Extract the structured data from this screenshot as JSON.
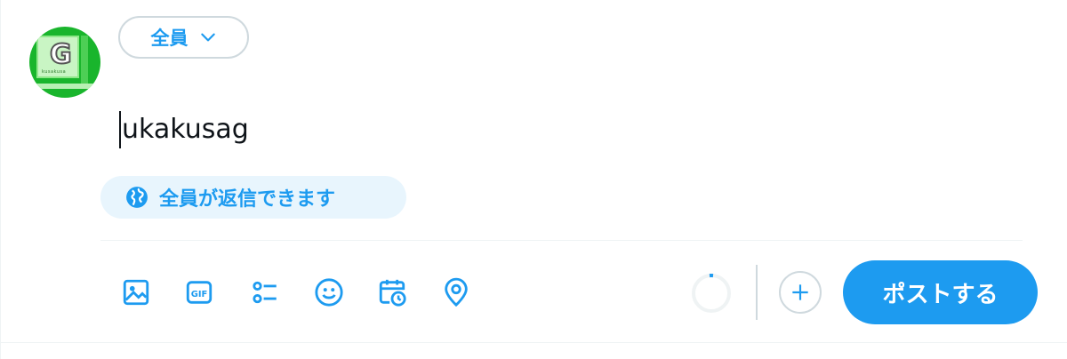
{
  "audience": {
    "label": "全員",
    "icon": "chevron-down-icon"
  },
  "avatar": {
    "letter": "G",
    "subtext": "kusakusa"
  },
  "composer": {
    "text": "ukakusag"
  },
  "reply_setting": {
    "label": "全員が返信できます",
    "icon": "globe-icon"
  },
  "toolbar": {
    "icons": [
      "image-icon",
      "gif-icon",
      "poll-icon",
      "emoji-icon",
      "schedule-icon",
      "location-icon"
    ],
    "gif_text": "GIF"
  },
  "post_button": {
    "label": "ポストする"
  },
  "colors": {
    "accent": "#1d9bf0",
    "border": "#cfd9de",
    "pill_bg": "#e8f5fd",
    "avatar_bg": "#19b52c"
  }
}
